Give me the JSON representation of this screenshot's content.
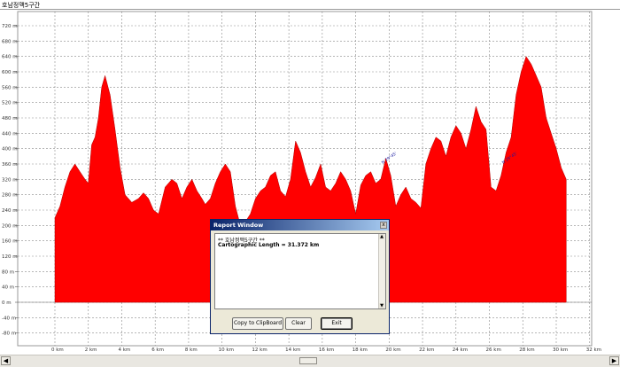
{
  "window": {
    "title": "호남정맥5구간"
  },
  "chart_data": {
    "type": "area",
    "xlabel": "",
    "ylabel": "",
    "xlim": [
      -1,
      33
    ],
    "ylim": [
      -20,
      740
    ],
    "x_ticks": [
      0,
      2,
      4,
      6,
      8,
      10,
      12,
      14,
      16,
      18,
      20,
      22,
      24,
      26,
      28,
      30,
      32
    ],
    "x_tick_labels": [
      "0 km",
      "2 km",
      "4 km",
      "6 km",
      "8 km",
      "10 km",
      "12 km",
      "14 km",
      "16 km",
      "18 km",
      "20 km",
      "22 km",
      "24 km",
      "26 km",
      "28 km",
      "30 km",
      "32 km"
    ],
    "y_ticks": [
      720,
      680,
      640,
      600,
      560,
      520,
      480,
      440,
      400,
      360,
      320,
      280,
      240,
      200,
      160,
      120,
      80,
      40,
      0,
      -40,
      -80
    ],
    "y_tick_labels": [
      "720 m",
      "680 m",
      "640 m",
      "600 m",
      "560 m",
      "520 m",
      "480 m",
      "440 m",
      "400 m",
      "360 m",
      "320 m",
      "280 m",
      "240 m",
      "200 m",
      "160 m",
      "120 m",
      "80 m",
      "40 m",
      "0 m",
      "-40 m",
      "-80 m"
    ],
    "fill_color": "#ff0000",
    "grid": true,
    "series": [
      {
        "x": [
          0,
          0.3,
          0.6,
          0.9,
          1.2,
          1.5,
          1.8,
          2.0,
          2.2,
          2.4,
          2.6,
          2.8,
          3.0,
          3.3,
          3.6,
          3.9,
          4.2,
          4.6,
          5.0,
          5.3,
          5.6,
          5.9,
          6.2,
          6.6,
          7.0,
          7.3,
          7.6,
          7.9,
          8.2,
          8.5,
          8.8,
          9.0,
          9.3,
          9.6,
          9.9,
          10.2,
          10.5,
          10.8,
          11.1,
          11.4,
          11.7,
          12.0,
          12.3,
          12.6,
          12.9,
          13.2,
          13.5,
          13.8,
          14.1,
          14.4,
          14.7,
          15.0,
          15.3,
          15.6,
          15.9,
          16.2,
          16.5,
          16.8,
          17.1,
          17.4,
          17.7,
          18.0,
          18.3,
          18.6,
          18.9,
          19.2,
          19.5,
          19.8,
          20.1,
          20.4,
          20.7,
          21.0,
          21.3,
          21.6,
          21.9,
          22.2,
          22.5,
          22.8,
          23.1,
          23.4,
          23.7,
          24.0,
          24.3,
          24.6,
          24.9,
          25.2,
          25.5,
          25.8,
          26.1,
          26.4,
          26.7,
          27.0,
          27.3,
          27.6,
          27.9,
          28.2,
          28.5,
          28.8,
          29.1,
          29.4,
          29.7,
          30.0,
          30.3,
          30.6,
          30.6
        ],
        "y": [
          220,
          250,
          300,
          340,
          360,
          340,
          320,
          310,
          410,
          430,
          480,
          560,
          590,
          540,
          450,
          350,
          280,
          260,
          270,
          285,
          270,
          240,
          230,
          300,
          320,
          310,
          270,
          300,
          320,
          290,
          270,
          255,
          270,
          310,
          340,
          360,
          340,
          250,
          200,
          210,
          230,
          270,
          290,
          300,
          330,
          340,
          290,
          275,
          320,
          420,
          390,
          340,
          300,
          325,
          360,
          300,
          290,
          310,
          340,
          320,
          290,
          230,
          305,
          330,
          340,
          310,
          320,
          375,
          330,
          250,
          280,
          300,
          270,
          260,
          245,
          360,
          400,
          430,
          420,
          380,
          430,
          460,
          440,
          400,
          450,
          510,
          470,
          450,
          300,
          290,
          330,
          390,
          430,
          540,
          600,
          640,
          620,
          590,
          560,
          480,
          440,
          400,
          350,
          320,
          0
        ],
        "name": ""
      }
    ],
    "annotations": [
      "N 29°45'",
      "N 29°45'"
    ]
  },
  "report": {
    "title": "Report Window",
    "close_label": "x",
    "line1": "** 호남정맥5구간 **",
    "line2": "Cartographic Length = 31.372 km",
    "scroll_up": "▲",
    "scroll_down": "▼",
    "buttons": {
      "copy": "Copy to ClipBoard",
      "clear": "Clear",
      "exit": "Exit"
    }
  },
  "hscroll": {
    "left": "◀",
    "right": "▶"
  }
}
